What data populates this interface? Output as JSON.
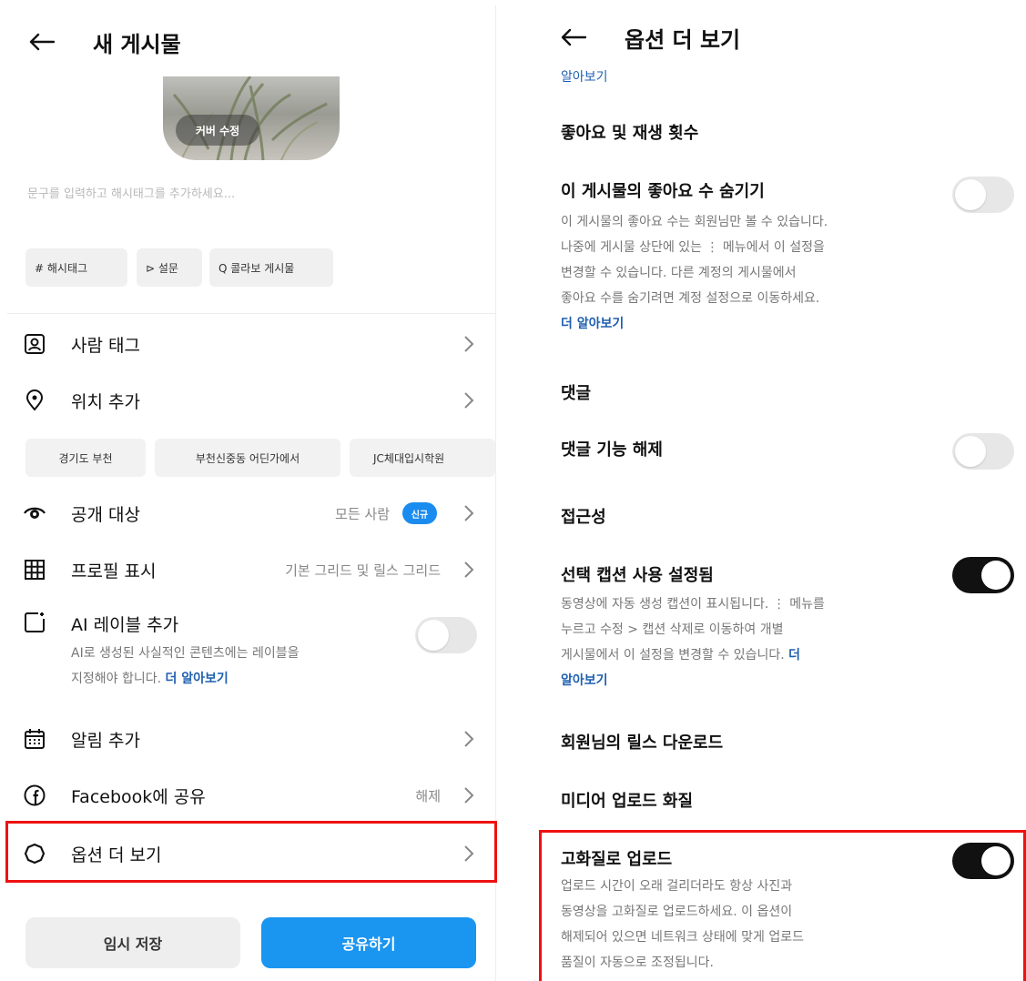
{
  "left": {
    "title": "새 게시물",
    "cover_button": "커버 수정",
    "caption_placeholder": "문구를 입력하고 해시태그를 추가하세요...",
    "chips": [
      "# 해시태그",
      "⊳ 설문",
      "Q 콜라보 게시물"
    ],
    "tag_people": "사람 태그",
    "add_location": "위치 추가",
    "location_chips": [
      "경기도 부천",
      "부천신중동 어딘가에서",
      "JC체대입시학원"
    ],
    "audience": {
      "label": "공개 대상",
      "value": "모든 사람",
      "badge": "신규"
    },
    "profile_display": {
      "label": "프로필 표시",
      "value": "기본 그리드 및 릴스 그리드"
    },
    "ai_label": {
      "label": "AI 레이블 추가",
      "desc_line1": "AI로 생성된 사실적인 콘텐츠에는 레이블을",
      "desc_line2": "지정해야 합니다. ",
      "link": "더 알아보기",
      "toggle": "off"
    },
    "add_reminder": "알림 추가",
    "share_facebook": {
      "label": "Facebook에 공유",
      "value": "해제"
    },
    "more_options": "옵션 더 보기",
    "save_draft": "임시 저장",
    "share": "공유하기"
  },
  "right": {
    "title": "옵션 더 보기",
    "top_link": "알아보기",
    "likes_views_section": "좋아요 및 재생 횟수",
    "hide_likes": {
      "title": "이 게시물의 좋아요 수 숨기기",
      "lines": [
        "이 게시물의 좋아요 수는 회원님만 볼 수 있습니다.",
        "나중에 게시물 상단에 있는 ⋮ 메뉴에서 이 설정을",
        "변경할 수 있습니다. 다른 계정의 게시물에서",
        "좋아요 수를 숨기려면 계정 설정으로 이동하세요."
      ],
      "link": "더 알아보기",
      "toggle": "off"
    },
    "comments_section": "댓글",
    "turn_off_comments": {
      "title": "댓글 기능 해제",
      "toggle": "off"
    },
    "accessibility_section": "접근성",
    "captions": {
      "title": "선택 캡션 사용 설정됨",
      "line1": "동영상에 자동 생성 캡션이 표시됩니다. ⋮ 메뉴를",
      "line2": "누르고 수정 > 캡션 삭제로 이동하여 개별",
      "line3": "게시물에서 이 설정을 변경할 수 있습니다. ",
      "link_part1": "더",
      "link_part2": "알아보기",
      "toggle": "on"
    },
    "download_reels": "회원님의 릴스 다운로드",
    "media_quality_section": "미디어 업로드 화질",
    "hq_upload": {
      "title": "고화질로 업로드",
      "lines": [
        "업로드 시간이 오래 걸리더라도 항상 사진과",
        "동영상을 고화질로 업로드하세요. 이 옵션이",
        "해제되어 있으면 네트워크 상태에 맞게 업로드",
        "품질이 자동으로 조정됩니다."
      ],
      "toggle": "on"
    }
  },
  "colors": {
    "accent_blue": "#1a95f0",
    "link_blue": "#1f5fb0",
    "highlight_red": "#e11111"
  }
}
